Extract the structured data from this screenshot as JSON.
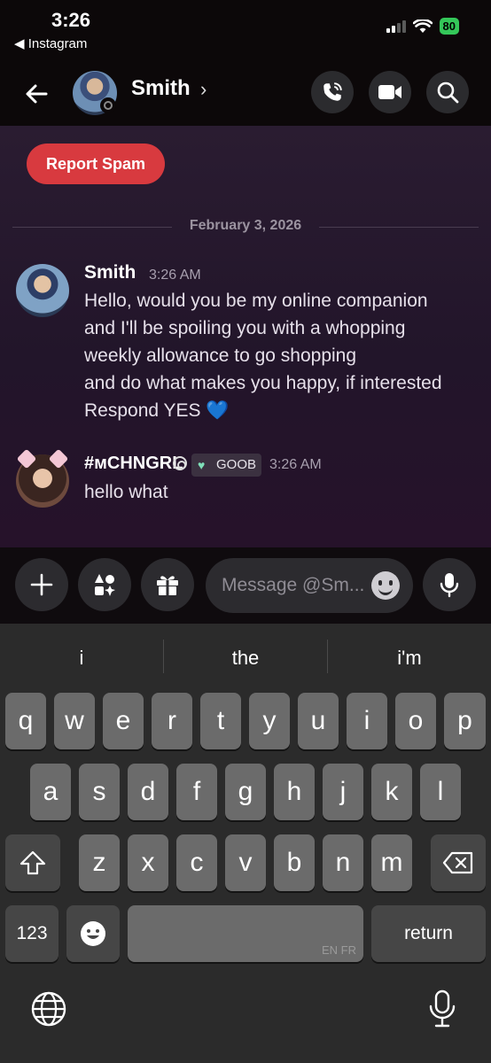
{
  "status_bar": {
    "time": "3:26",
    "back_app": "◀ Instagram",
    "battery": "80"
  },
  "header": {
    "name": "Smith",
    "chevron": "›",
    "icons": [
      "back-arrow-icon",
      "voice-call-icon",
      "video-call-icon",
      "search-icon"
    ]
  },
  "chat": {
    "report_spam": "Report Spam",
    "date": "February 3, 2026",
    "messages": [
      {
        "author": "Smith",
        "time": "3:26 AM",
        "lines": [
          "Hello, would you be my online companion",
          "and I'll be spoiling you with a whopping",
          "weekly allowance to go shopping",
          "and do what makes you happy, if interested",
          "Respond YES 💙"
        ]
      },
      {
        "author": "#ᴍCHNGRL",
        "badge": "GOOB",
        "time": "3:26 AM",
        "lines": [
          "hello what"
        ]
      }
    ]
  },
  "composer": {
    "placeholder": "Message @Sm...",
    "icons": [
      "plus-icon",
      "apps-icon",
      "gift-icon",
      "emoji-icon",
      "microphone-icon"
    ]
  },
  "keyboard": {
    "suggestions": [
      "i",
      "the",
      "i'm"
    ],
    "row1": [
      "q",
      "w",
      "e",
      "r",
      "t",
      "y",
      "u",
      "i",
      "o",
      "p"
    ],
    "row2": [
      "a",
      "s",
      "d",
      "f",
      "g",
      "h",
      "j",
      "k",
      "l"
    ],
    "row3": [
      "z",
      "x",
      "c",
      "v",
      "b",
      "n",
      "m"
    ],
    "numbers_key": "123",
    "return_key": "return",
    "space_hint": "EN FR"
  }
}
